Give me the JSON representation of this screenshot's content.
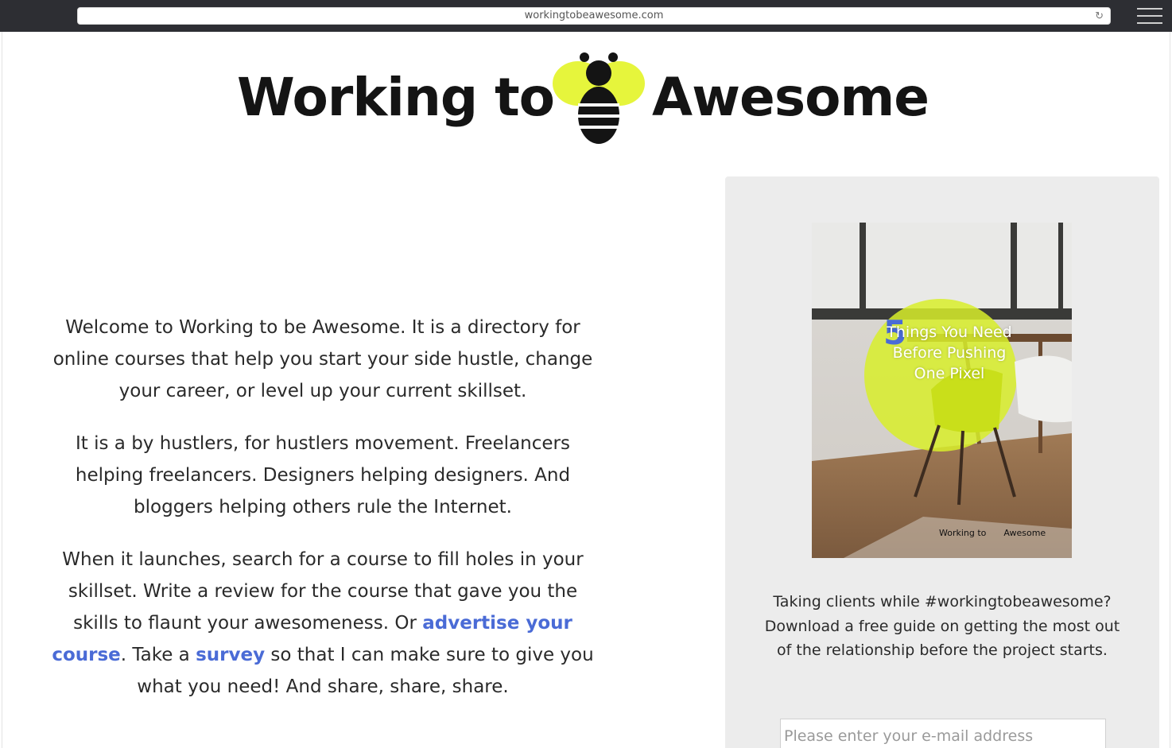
{
  "browser": {
    "url": "workingtobeawesome.com",
    "reload_icon": "reload-icon",
    "menu_icon": "hamburger-menu-icon"
  },
  "logo": {
    "word_left": "Working to",
    "word_right": "Awesome",
    "icon": "bee-icon",
    "colors": {
      "bee_wings": "#e6f53c",
      "bee_body": "#141414"
    }
  },
  "intro": {
    "p1": "Welcome to Working to be Awesome. It is a directory for online courses that help you start your side hustle, change your career, or level up your current skillset.",
    "p2": "It is a by hustlers, for hustlers movement. Freelancers helping freelancers. Designers helping designers. And bloggers helping others rule the Internet.",
    "p3_before_link1": "When it launches, search for a course to fill holes in your skillset. Write a review for the course that gave you the skills to flaunt your awesomeness. Or ",
    "link_advertise": "advertise your course",
    "p3_between": ". Take a ",
    "link_survey": "survey",
    "p3_after_link2": " so that I can make sure to give you what you need! And share, share, share."
  },
  "sidebar": {
    "cover": {
      "number": "5",
      "title": "Things You Need Before Pushing One Pixel",
      "brand_left": "Working to",
      "brand_right": "Awesome"
    },
    "promo_text": "Taking clients while #workingtobeawesome? Download a free guide on getting the most out of the relationship before the project starts.",
    "email_placeholder": "Please enter your e-mail address"
  },
  "colors": {
    "link": "#4a6bd6",
    "sidebar_bg": "#ececec",
    "accent": "#d8ee2a"
  }
}
